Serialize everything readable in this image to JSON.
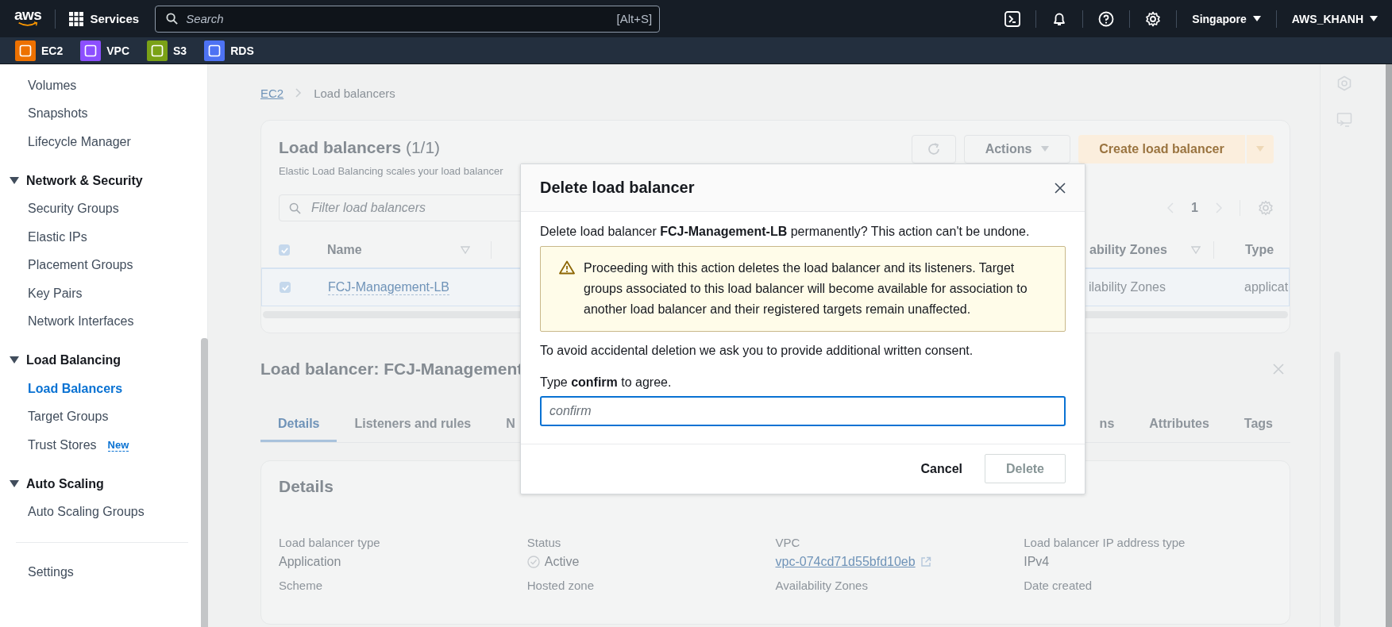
{
  "top_nav": {
    "logo": "aws",
    "services": "Services",
    "search": {
      "placeholder": "Search",
      "shortcut": "[Alt+S]"
    },
    "region": "Singapore",
    "account": "AWS_KHANH"
  },
  "favorites": [
    {
      "label": "EC2",
      "color": "#ed7100"
    },
    {
      "label": "VPC",
      "color": "#8c4fff"
    },
    {
      "label": "S3",
      "color": "#7aa116"
    },
    {
      "label": "RDS",
      "color": "#4d72f3"
    }
  ],
  "sidebar": {
    "groups": [
      {
        "items": [
          {
            "label": "Volumes",
            "selected": false
          },
          {
            "label": "Snapshots",
            "selected": false
          },
          {
            "label": "Lifecycle Manager",
            "selected": false
          }
        ]
      },
      {
        "title": "Network & Security",
        "expanded": true,
        "items": [
          {
            "label": "Security Groups",
            "selected": false
          },
          {
            "label": "Elastic IPs",
            "selected": false
          },
          {
            "label": "Placement Groups",
            "selected": false
          },
          {
            "label": "Key Pairs",
            "selected": false
          },
          {
            "label": "Network Interfaces",
            "selected": false
          }
        ]
      },
      {
        "title": "Load Balancing",
        "expanded": true,
        "items": [
          {
            "label": "Load Balancers",
            "selected": true
          },
          {
            "label": "Target Groups",
            "selected": false
          },
          {
            "label": "Trust Stores",
            "badge": "New",
            "selected": false
          }
        ]
      },
      {
        "title": "Auto Scaling",
        "expanded": true,
        "items": [
          {
            "label": "Auto Scaling Groups",
            "selected": false
          }
        ]
      }
    ],
    "footer_item": "Settings"
  },
  "breadcrumb": [
    "EC2",
    "Load balancers"
  ],
  "load_balancers_panel": {
    "title": "Load balancers",
    "count": "(1/1)",
    "description": "Elastic Load Balancing scales your load balancer",
    "actions": "Actions",
    "create": "Create load balancer",
    "filter_placeholder": "Filter load balancers",
    "page": "1",
    "all_checked": true,
    "columns_left": [
      "Name"
    ],
    "columns_right": [
      "ability Zones",
      "Type"
    ],
    "rows": [
      {
        "checked": true,
        "name": "FCJ-Management-LB",
        "zones": "ilability Zones",
        "type": "applicat"
      }
    ]
  },
  "detail_panel": {
    "title": "Load balancer: FCJ-Management",
    "tab_groups": [
      {
        "tabs": [
          {
            "label": "Details",
            "selected": true
          },
          {
            "label": "Listeners and rules",
            "selected": false
          },
          {
            "label": "N",
            "selected": false
          }
        ]
      },
      {
        "tabs": [
          {
            "label": "ns",
            "selected": false
          },
          {
            "label": "Attributes",
            "selected": false
          },
          {
            "label": "Tags",
            "selected": false
          }
        ]
      }
    ],
    "heading": "Details",
    "fields": [
      {
        "label": "Load balancer type",
        "value": "Application",
        "kind": "text"
      },
      {
        "label": "Status",
        "value": "Active",
        "kind": "status"
      },
      {
        "label": "VPC",
        "value": "vpc-074cd71d55bfd10eb",
        "kind": "link"
      },
      {
        "label": "Load balancer IP address type",
        "value": "IPv4",
        "kind": "text"
      },
      {
        "label": "Scheme"
      },
      {
        "label": "Hosted zone"
      },
      {
        "label": "Availability Zones"
      },
      {
        "label": "Date created"
      }
    ]
  },
  "modal": {
    "title": "Delete load balancer",
    "message": "Delete load balancer **FCJ-Management-LB** permanently? This action can't be undone.",
    "warning": "Proceeding with this action deletes the load balancer and its listeners. Target groups associated to this load balancer will become available for association to another load balancer and their registered targets remain unaffected.",
    "consent": "To avoid accidental deletion we ask you to provide additional written consent.",
    "prompt": "Type **confirm** to agree.",
    "input": {
      "placeholder": "confirm"
    },
    "buttons": [
      {
        "label": "Cancel",
        "kind": "link",
        "disabled": false
      },
      {
        "label": "Delete",
        "kind": "primary",
        "disabled": true
      }
    ]
  }
}
